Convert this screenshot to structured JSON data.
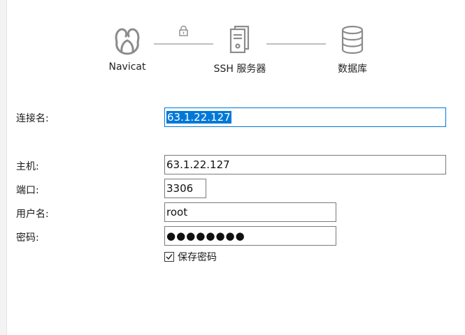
{
  "diagram": {
    "nodes": [
      {
        "label": "Navicat",
        "icon": "navicat-logo-icon"
      },
      {
        "label": "SSH 服务器",
        "icon": "server-icon"
      },
      {
        "label": "数据库",
        "icon": "database-icon"
      }
    ],
    "connector_icon": "lock-icon"
  },
  "form": {
    "connection_name": {
      "label": "连接名:",
      "value": "63.1.22.127"
    },
    "host": {
      "label": "主机:",
      "value": "63.1.22.127"
    },
    "port": {
      "label": "端口:",
      "value": "3306"
    },
    "username": {
      "label": "用户名:",
      "value": "root"
    },
    "password": {
      "label": "密码:",
      "value": "●●●●●●●●"
    },
    "save_password": {
      "label": "保存密码",
      "checked": true
    }
  },
  "colors": {
    "focus_border": "#0078d7",
    "selection": "#0078d7",
    "icon_gray": "#8c8c8c"
  }
}
